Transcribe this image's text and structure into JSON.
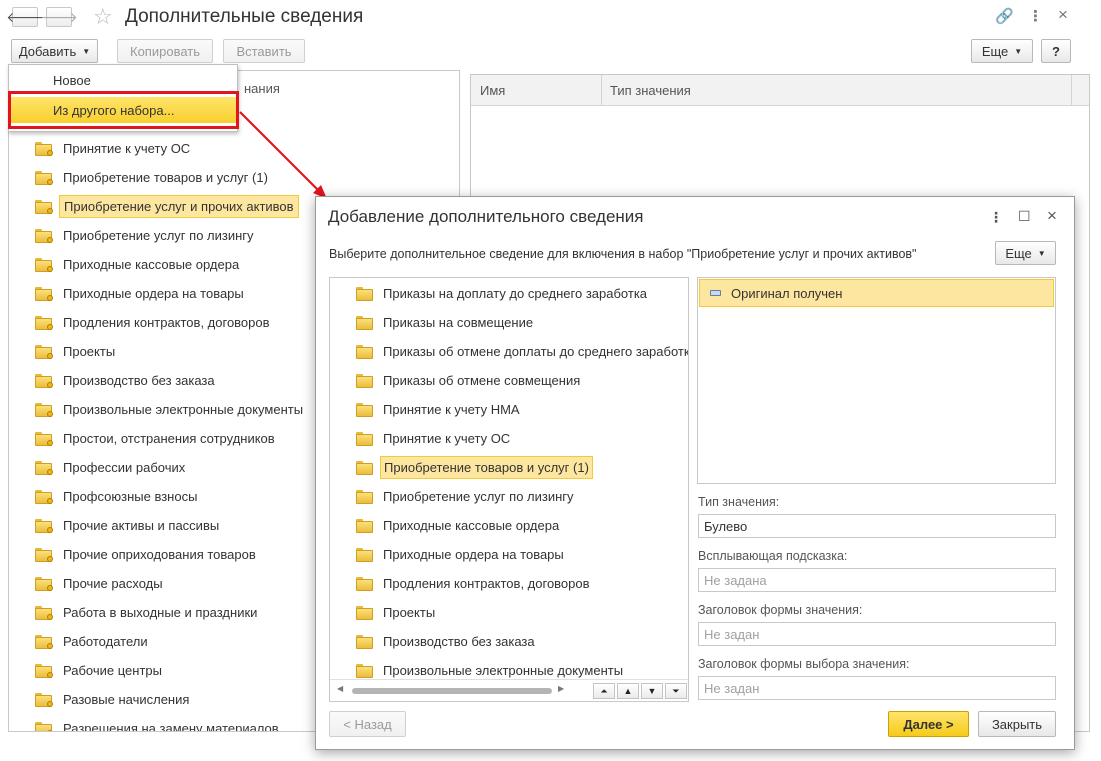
{
  "window": {
    "title": "Дополнительные сведения",
    "back_icon": "arrow-left-icon",
    "forward_icon": "arrow-right-icon"
  },
  "toolbar": {
    "add_label": "Добавить",
    "copy_label": "Копировать",
    "paste_label": "Вставить",
    "more_label": "Еще",
    "help_label": "?"
  },
  "add_menu": {
    "items": [
      {
        "label": "Новое"
      },
      {
        "label": "Из другого набора..."
      }
    ]
  },
  "left_header_fragment": "нания",
  "left_tree": {
    "items": [
      {
        "label": "Принятие к учету ОС"
      },
      {
        "label": "Приобретение товаров и услуг (1)"
      },
      {
        "label": "Приобретение услуг и прочих активов",
        "selected": true
      },
      {
        "label": "Приобретение услуг по лизингу"
      },
      {
        "label": "Приходные кассовые ордера"
      },
      {
        "label": "Приходные ордера на товары"
      },
      {
        "label": "Продления контрактов, договоров"
      },
      {
        "label": "Проекты"
      },
      {
        "label": "Производство без заказа"
      },
      {
        "label": "Произвольные электронные документы"
      },
      {
        "label": "Простои, отстранения сотрудников"
      },
      {
        "label": "Профессии рабочих"
      },
      {
        "label": "Профсоюзные взносы"
      },
      {
        "label": "Прочие активы и пассивы"
      },
      {
        "label": "Прочие оприходования товаров"
      },
      {
        "label": "Прочие расходы"
      },
      {
        "label": "Работа в выходные и праздники"
      },
      {
        "label": "Работодатели"
      },
      {
        "label": "Рабочие центры"
      },
      {
        "label": "Разовые начисления"
      },
      {
        "label": "Разрешения на замену материалов"
      }
    ]
  },
  "right_grid": {
    "columns": [
      "Имя",
      "Тип значения"
    ]
  },
  "dialog": {
    "title": "Добавление дополнительного сведения",
    "hint": "Выберите дополнительное сведение для включения в набор \"Приобретение услуг и прочих активов\"",
    "more_label": "Еще",
    "tree": [
      {
        "label": "Приказы на доплату до среднего заработка"
      },
      {
        "label": "Приказы на совмещение"
      },
      {
        "label": "Приказы об отмене доплаты до среднего заработка"
      },
      {
        "label": "Приказы об отмене совмещения"
      },
      {
        "label": "Принятие к учету НМА"
      },
      {
        "label": "Принятие к учету ОС"
      },
      {
        "label": "Приобретение товаров и услуг (1)",
        "selected": true
      },
      {
        "label": "Приобретение услуг по лизингу"
      },
      {
        "label": "Приходные кассовые ордера"
      },
      {
        "label": "Приходные ордера на товары"
      },
      {
        "label": "Продления контрактов, договоров"
      },
      {
        "label": "Проекты"
      },
      {
        "label": "Производство без заказа"
      },
      {
        "label": "Произвольные электронные документы"
      }
    ],
    "selected_property": "Оригинал получен",
    "fields": {
      "value_type_label": "Тип значения:",
      "value_type": "Булево",
      "tooltip_label": "Всплывающая подсказка:",
      "tooltip_placeholder": "Не задана",
      "form_title_label": "Заголовок формы значения:",
      "form_title_placeholder": "Не задан",
      "choice_title_label": "Заголовок формы выбора значения:",
      "choice_title_placeholder": "Не задан"
    },
    "back_label": "< Назад",
    "next_label": "Далее >",
    "close_label": "Закрыть"
  },
  "colors": {
    "highlight": "#fde7a0",
    "primary_button": "#f5cc1a",
    "annotation_red": "#e0161c"
  }
}
